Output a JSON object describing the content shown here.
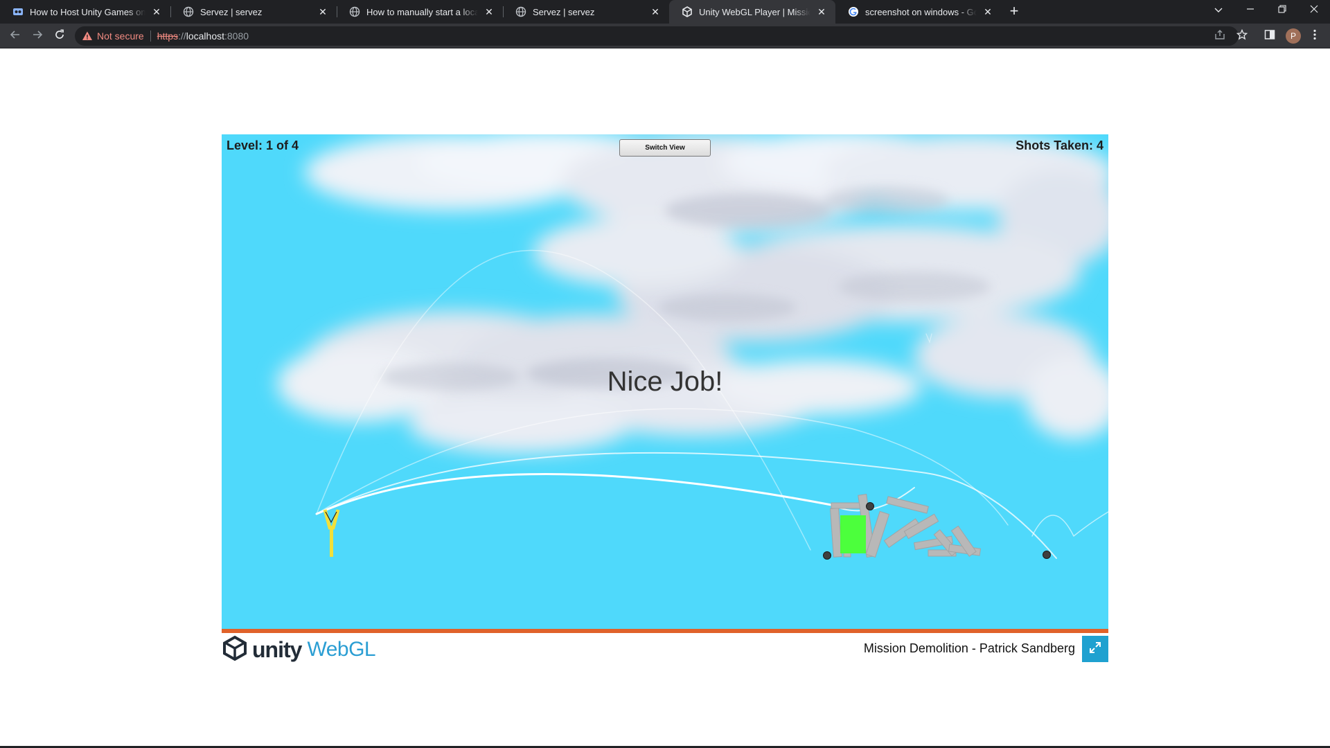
{
  "browser": {
    "tabs": [
      {
        "title": "How to Host Unity Games on the",
        "favicon": "itch-icon"
      },
      {
        "title": "Servez | servez",
        "favicon": "globe-icon"
      },
      {
        "title": "How to manually start a localhost",
        "favicon": "globe-icon"
      },
      {
        "title": "Servez | servez",
        "favicon": "globe-icon"
      },
      {
        "title": "Unity WebGL Player | Mission De",
        "favicon": "unity-icon",
        "active": true
      },
      {
        "title": "screenshot on windows - Google",
        "favicon": "google-icon"
      }
    ],
    "address": {
      "security_label": "Not secure",
      "protocol": "https",
      "separator": "://",
      "host": "localhost",
      "port": ":8080"
    },
    "profile_initial": "P"
  },
  "game": {
    "level_text": "Level: 1 of 4",
    "shots_text": "Shots Taken: 4",
    "switch_view_label": "Switch View",
    "message": "Nice Job!"
  },
  "footer": {
    "unity_word": "unity",
    "webgl_word": "WebGL",
    "game_title": "Mission Demolition - Patrick Sandberg"
  },
  "colors": {
    "sky": "#4fd9fb",
    "ground": "#e0622a",
    "goal": "#4cff3c",
    "webgl_blue": "#2b9ed3",
    "fullscreen_button": "#1fa1d0"
  }
}
